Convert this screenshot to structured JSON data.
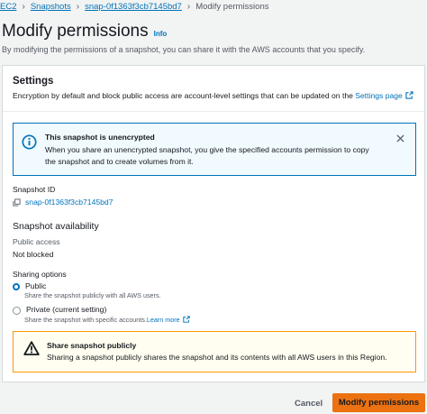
{
  "breadcrumb": {
    "items": [
      "EC2",
      "Snapshots",
      "snap-0f1363f3cb7145bd7"
    ],
    "current": "Modify permissions"
  },
  "page": {
    "title": "Modify permissions",
    "info_label": "Info",
    "description": "By modifying the permissions of a snapshot, you can share it with the AWS accounts that you specify."
  },
  "settings": {
    "title": "Settings",
    "description": "Encryption by default and block public access are account-level settings that can be updated on the",
    "link_label": "Settings page"
  },
  "info_flash": {
    "title": "This snapshot is unencrypted",
    "body": "When you share an unencrypted snapshot, you give the specified accounts permission to copy the snapshot and to create volumes from it."
  },
  "snapshot": {
    "id_label": "Snapshot ID",
    "id_value": "snap-0f1363f3cb7145bd7"
  },
  "availability": {
    "title": "Snapshot availability",
    "public_access_label": "Public access",
    "public_access_value": "Not blocked"
  },
  "sharing": {
    "label": "Sharing options",
    "options": [
      {
        "label": "Public",
        "description": "Share the snapshot publicly with all AWS users.",
        "selected": true
      },
      {
        "label": "Private (current setting)",
        "description": "Share the snapshot with specific accounts.",
        "link": "Learn more",
        "selected": false
      }
    ]
  },
  "warning_flash": {
    "title": "Share snapshot publicly",
    "body": "Sharing a snapshot publicly shares the snapshot and its contents with all AWS users in this Region."
  },
  "footer": {
    "cancel_label": "Cancel",
    "primary_label": "Modify permissions"
  },
  "colors": {
    "link": "#0073bb",
    "primary_button": "#ec7211",
    "info_border": "#0073bb",
    "warning_border": "#ff9900"
  }
}
